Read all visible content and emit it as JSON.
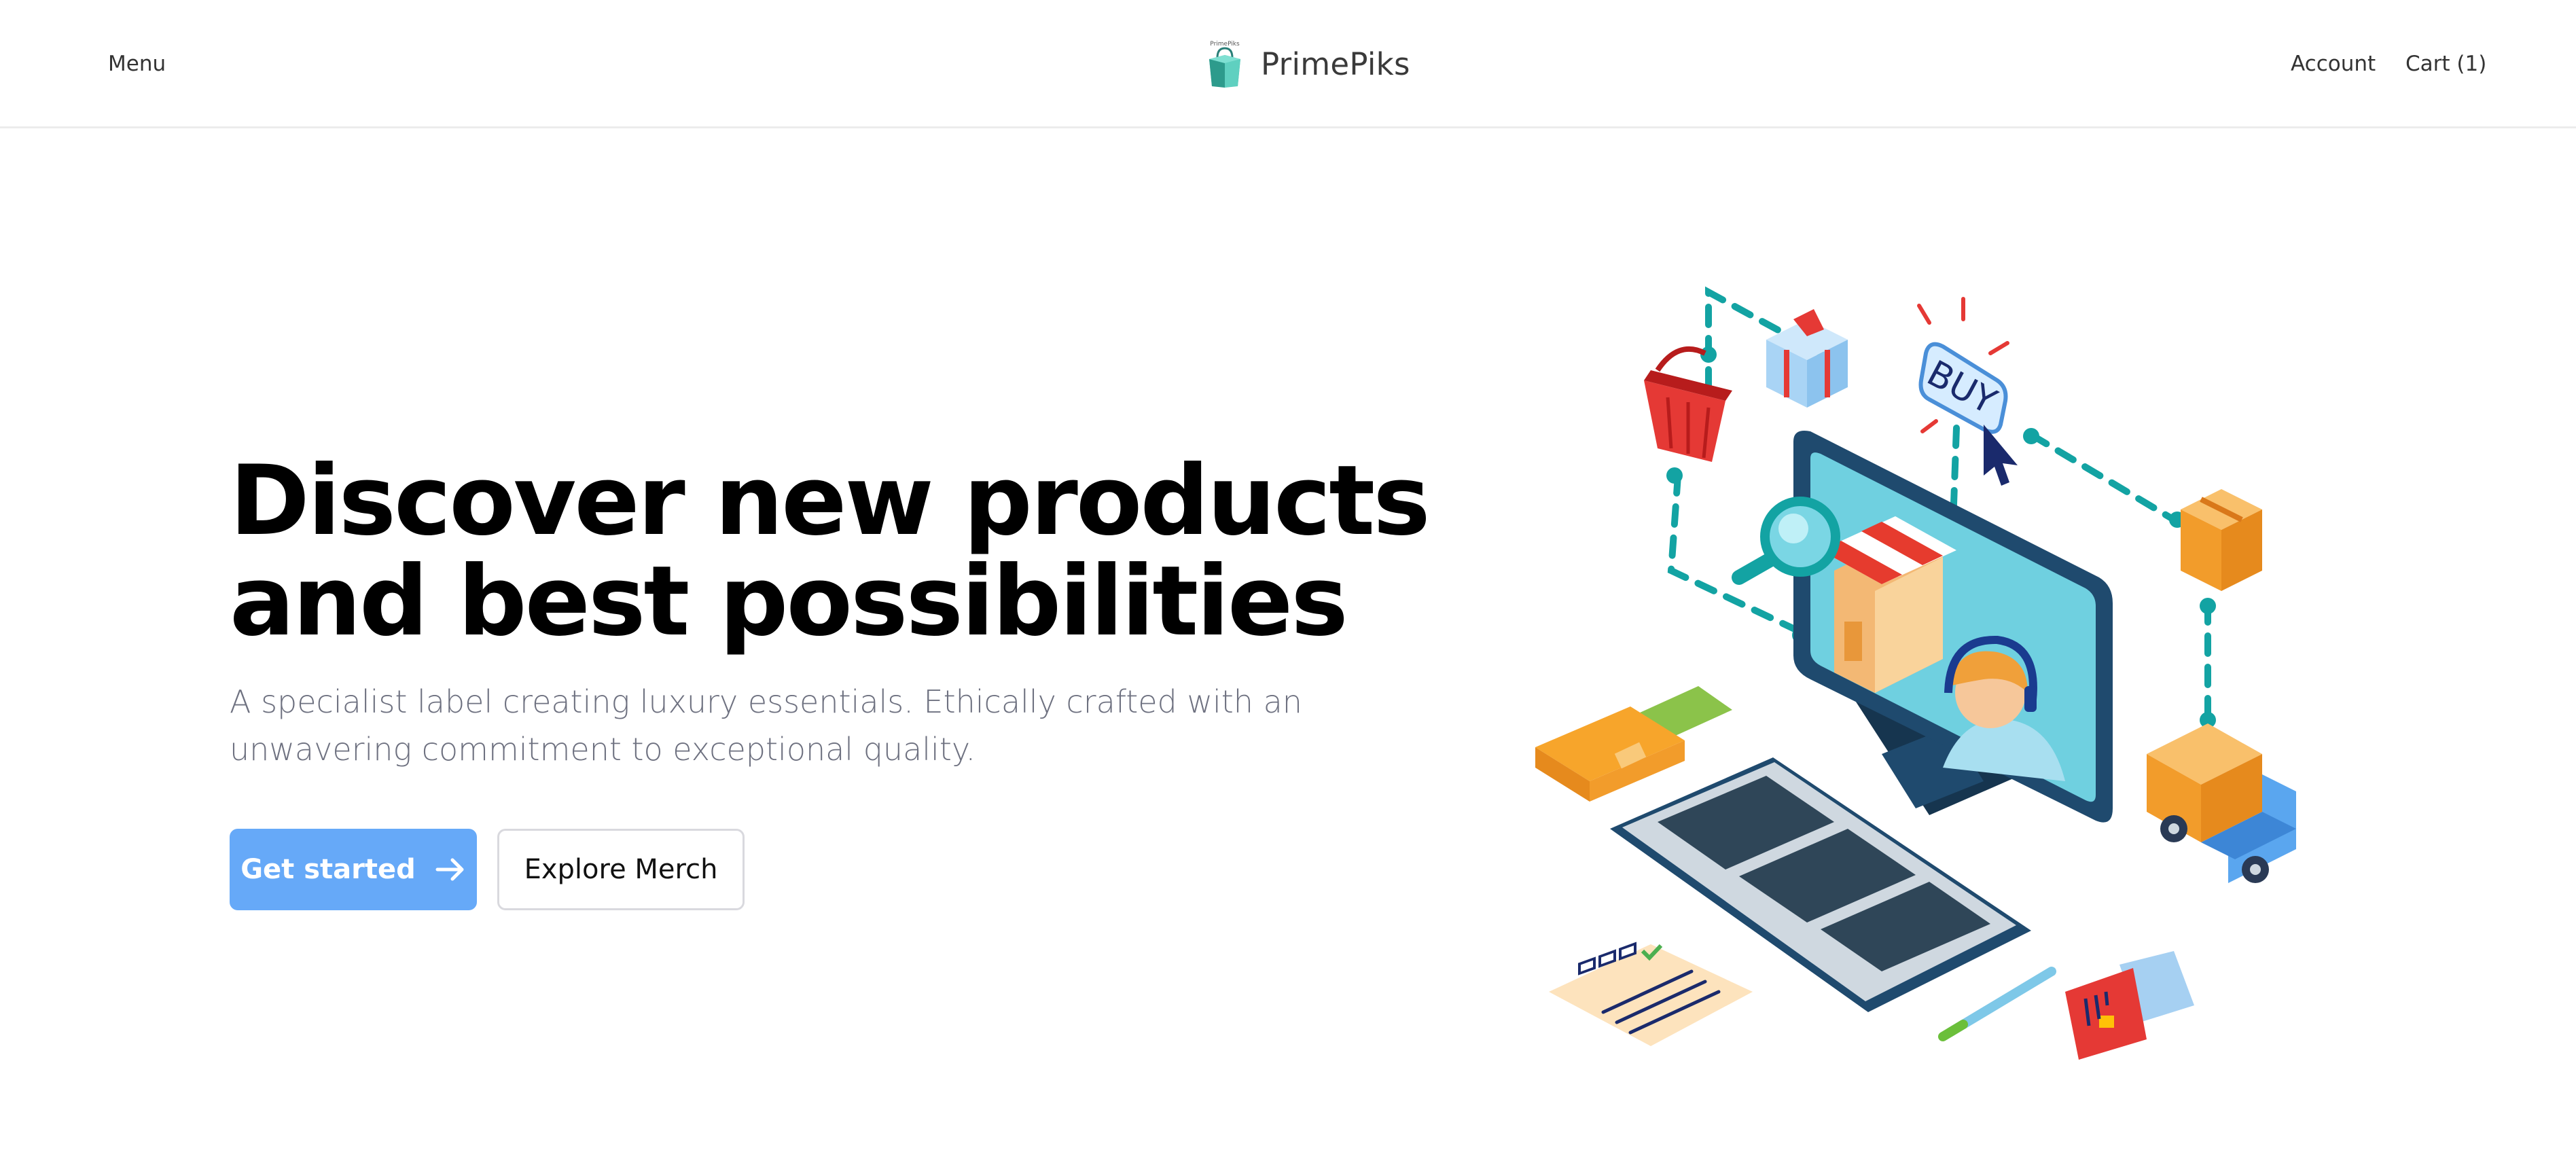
{
  "header": {
    "menu_label": "Menu",
    "brand_name": "PrimePiks",
    "brand_logo_text": "PrimePiks",
    "account_label": "Account",
    "cart_label": "Cart (1)"
  },
  "hero": {
    "title_line1": "Discover new products",
    "title_line2": "and best possibilities",
    "subtitle": "A specialist label creating luxury essentials. Ethically crafted with an unwavering commitment to exceptional quality.",
    "primary_button": "Get started",
    "primary_button_icon": "arrow-right-icon",
    "secondary_button": "Explore Merch"
  },
  "illustration": {
    "buy_sign_text": "BUY",
    "icons": [
      "shopping-basket-icon",
      "gift-box-icon",
      "buy-sign-icon",
      "cursor-icon",
      "magnifier-icon",
      "storefront-icon",
      "support-agent-icon",
      "package-box-icon",
      "delivery-truck-icon",
      "wallet-icon",
      "keyboard-icon",
      "checklist-icon",
      "pen-icon",
      "credit-card-icon",
      "monitor-icon"
    ]
  },
  "colors": {
    "primary_button": "#66a9f8",
    "title": "#000000",
    "subtitle": "#6e7180",
    "accent_teal": "#13a3a3",
    "monitor_navy": "#1f4a6e",
    "screen_cyan": "#6fd0e0"
  }
}
